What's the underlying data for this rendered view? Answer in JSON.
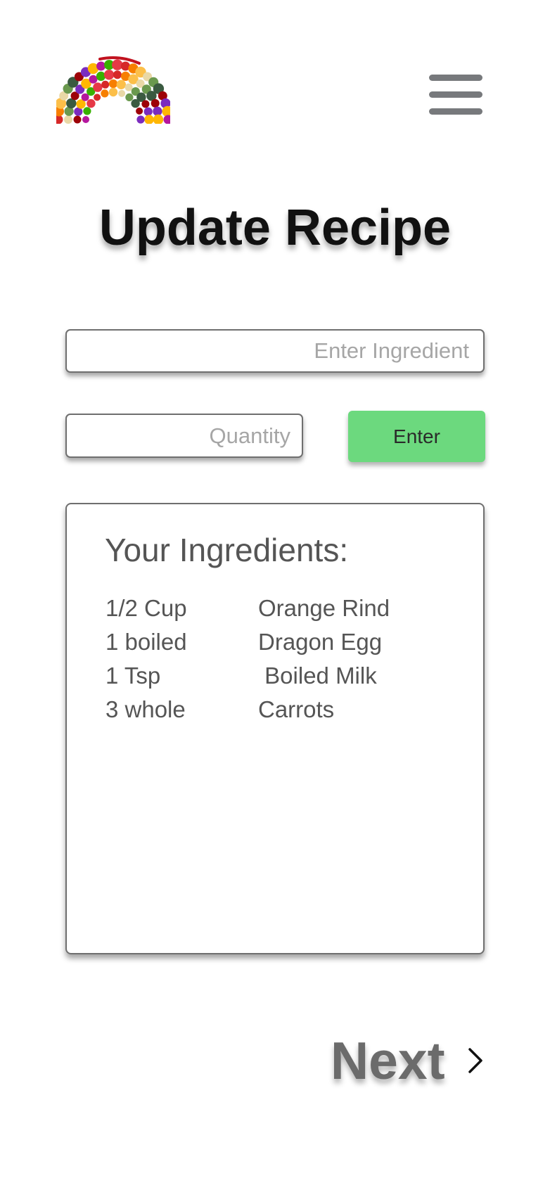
{
  "header": {
    "logo_icon": "fruit-vegetable-rainbow-logo",
    "menu_icon": "hamburger-menu-icon"
  },
  "page": {
    "title": "Update Recipe"
  },
  "form": {
    "ingredient_placeholder": "Enter Ingredient",
    "ingredient_value": "",
    "quantity_placeholder": "Quantity",
    "quantity_value": "",
    "enter_label": "Enter"
  },
  "ingredients": {
    "heading": "Your Ingredients:",
    "items": [
      {
        "quantity": "1/2 Cup",
        "name": "Orange Rind"
      },
      {
        "quantity": "1 boiled",
        "name": "Dragon Egg"
      },
      {
        "quantity": "1 Tsp",
        "name": " Boiled Milk"
      },
      {
        "quantity": "3 whole",
        "name": "Carrots"
      }
    ]
  },
  "footer": {
    "next_label": "Next",
    "next_icon": "chevron-right-icon"
  },
  "colors": {
    "enter_button": "#6cd97e",
    "menu_icon": "#77797c",
    "title": "#111111",
    "secondary_text": "#555555",
    "placeholder": "#a6a6a6"
  }
}
